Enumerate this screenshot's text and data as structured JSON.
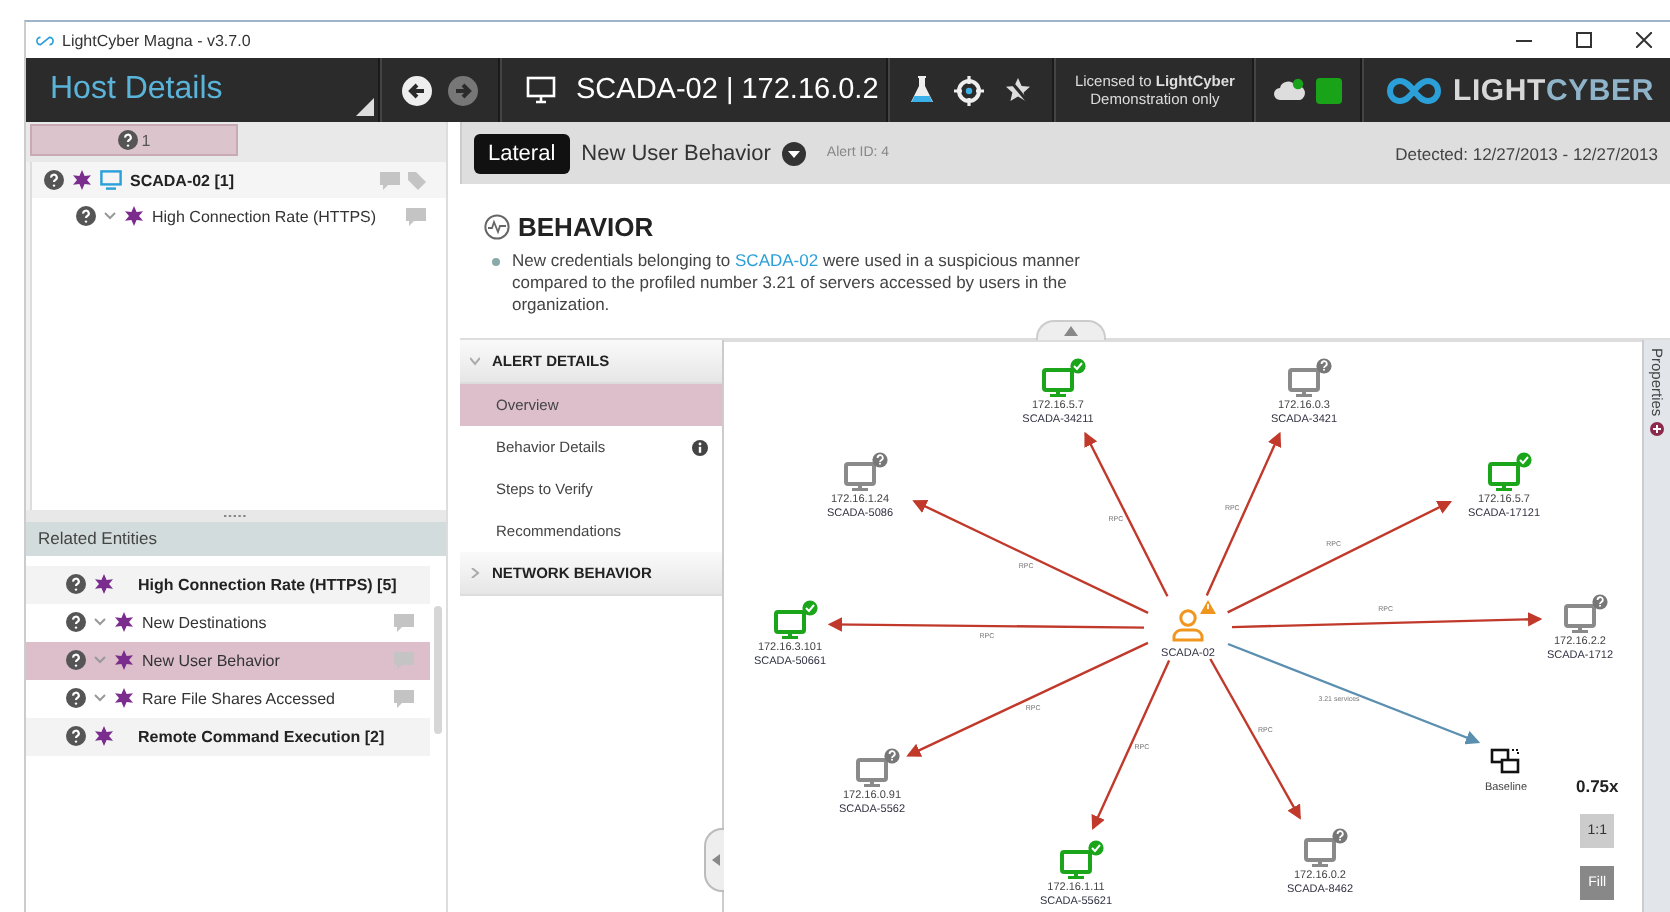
{
  "window": {
    "title": "LightCyber Magna - v3.7.0"
  },
  "header": {
    "title": "Host Details",
    "host": "SCADA-02 | 172.16.0.2",
    "license_line1": "Licensed to **LightCyber**",
    "license_line2": "Demonstration only",
    "logo_first": "LIGHT",
    "logo_second": "CYBER"
  },
  "filter_tab": {
    "count": "1",
    "selected": true
  },
  "tree": [
    {
      "label": "SCADA-02 [1]",
      "kind": "host",
      "children": [
        {
          "label": "High Connection Rate (HTTPS)",
          "kind": "alert"
        }
      ]
    }
  ],
  "related": {
    "title": "Related Entities",
    "items": [
      {
        "label": "High Connection Rate (HTTPS) [5]",
        "kind": "group",
        "selected": false
      },
      {
        "label": "New Destinations",
        "kind": "item",
        "selected": false
      },
      {
        "label": "New User Behavior",
        "kind": "item",
        "selected": true
      },
      {
        "label": "Rare File Shares Accessed",
        "kind": "item",
        "selected": false
      },
      {
        "label": "Remote Command Execution [2]",
        "kind": "group",
        "selected": false
      }
    ]
  },
  "alert": {
    "tag": "Lateral",
    "title": "New User Behavior",
    "alert_id": "Alert ID: 4",
    "detected": "Detected: 12/27/2013  -  12/27/2013"
  },
  "behavior": {
    "title": "BEHAVIOR",
    "before": "New credentials belonging to ",
    "link": "SCADA-02",
    "after": " were used in a suspicious manner compared to the profiled number 3.21 of servers accessed by users in the organization."
  },
  "menu": [
    {
      "title": "ALERT DETAILS",
      "expanded": true,
      "items": [
        {
          "label": "Overview",
          "selected": true,
          "info": false
        },
        {
          "label": "Behavior Details",
          "selected": false,
          "info": true
        },
        {
          "label": "Steps to Verify",
          "selected": false,
          "info": false
        },
        {
          "label": "Recommendations",
          "selected": false,
          "info": false
        }
      ]
    },
    {
      "title": "NETWORK BEHAVIOR",
      "expanded": false
    }
  ],
  "graph": {
    "center": {
      "name": "SCADA-02",
      "warning": true
    },
    "nodes": [
      {
        "ip": "172.16.5.7",
        "name": "SCADA-34211",
        "verified": true,
        "edge_label": "RPC"
      },
      {
        "ip": "172.16.0.3",
        "name": "SCADA-3421",
        "verified": false,
        "edge_label": "RPC"
      },
      {
        "ip": "172.16.5.7",
        "name": "SCADA-17121",
        "verified": true,
        "edge_label": "RPC"
      },
      {
        "ip": "172.16.2.2",
        "name": "SCADA-1712",
        "verified": false,
        "edge_label": "RPC"
      },
      {
        "ip": "172.16.0.2",
        "name": "SCADA-8462",
        "verified": false,
        "edge_label": "RPC"
      },
      {
        "ip": "172.16.1.11",
        "name": "SCADA-55621",
        "verified": true,
        "edge_label": "RPC"
      },
      {
        "ip": "172.16.0.91",
        "name": "SCADA-5562",
        "verified": false,
        "edge_label": "RPC"
      },
      {
        "ip": "172.16.3.101",
        "name": "SCADA-50661",
        "verified": true,
        "edge_label": "RPC"
      },
      {
        "ip": "172.16.1.24",
        "name": "SCADA-5086",
        "verified": false,
        "edge_label": "RPC"
      }
    ],
    "baseline": {
      "name": "Baseline",
      "edge_label": "3.21 services"
    },
    "zoom": "0.75x",
    "buttons": [
      "1:1",
      "Fill"
    ]
  },
  "properties_tab": "Properties"
}
